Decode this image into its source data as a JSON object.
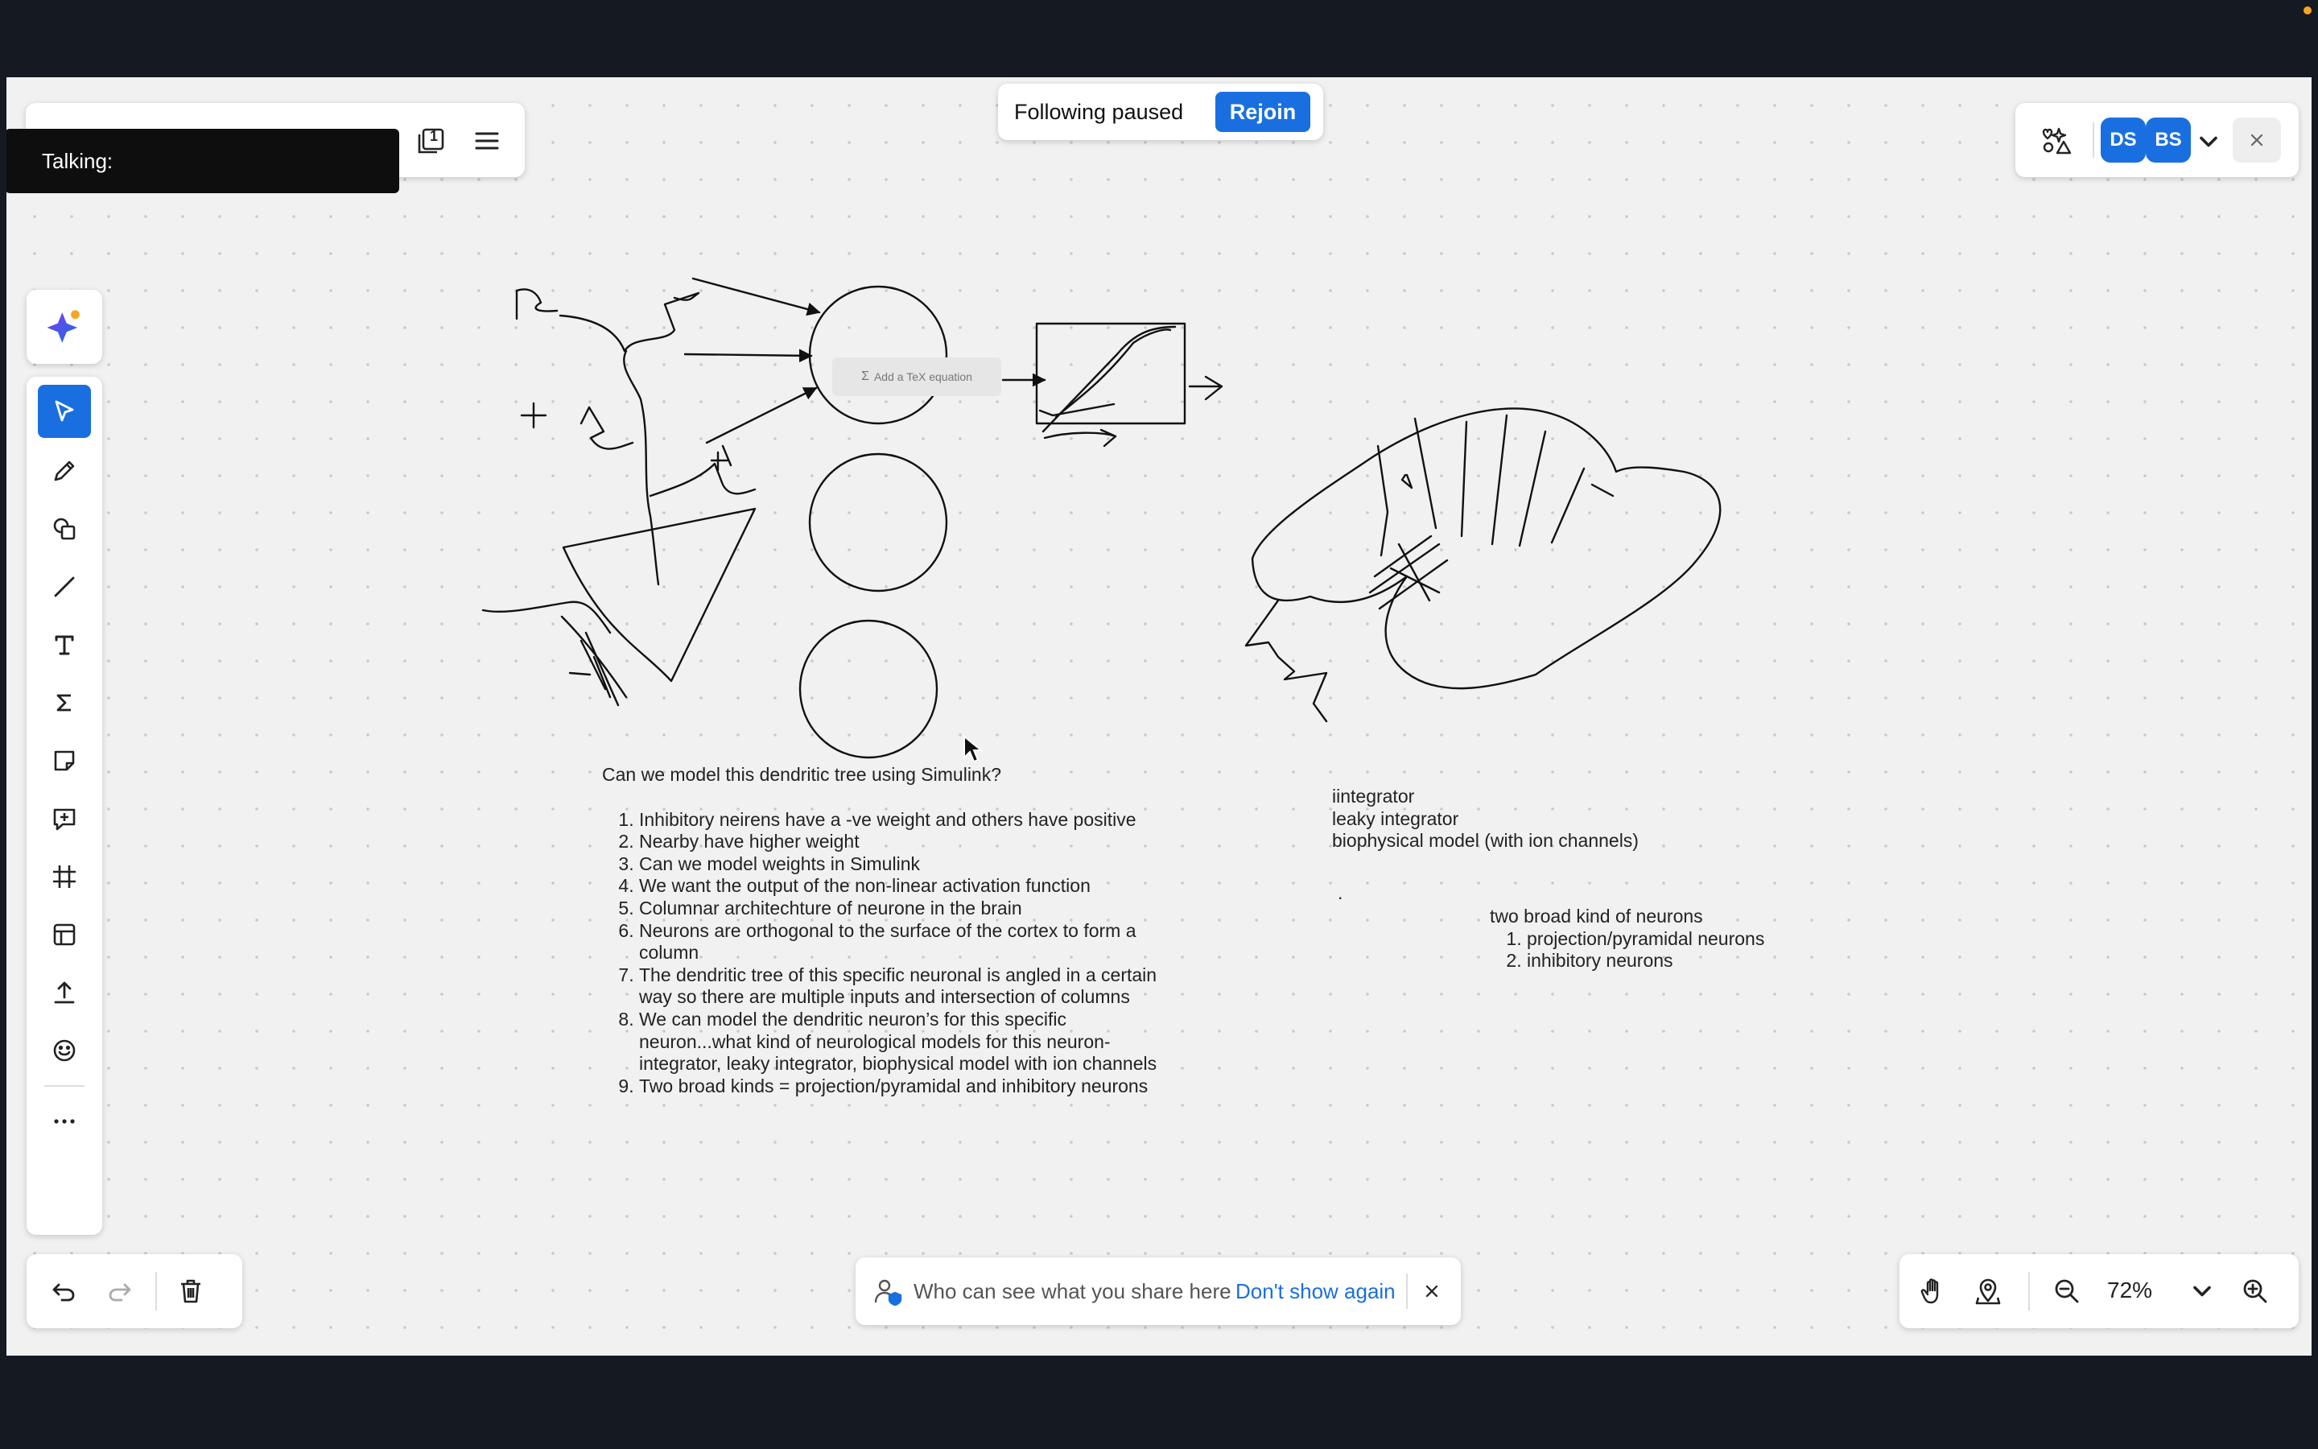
{
  "talking": {
    "label": "Talking:"
  },
  "frames": {
    "count": "1"
  },
  "following": {
    "text": "Following paused",
    "rejoin_label": "Rejoin"
  },
  "participants": [
    {
      "initials": "DS",
      "color": "#1a6fe0"
    },
    {
      "initials": "BS",
      "color": "#1a6fe0"
    }
  ],
  "tools": [
    "select",
    "pen",
    "shapes",
    "line",
    "text",
    "equation",
    "sticky-note",
    "comment",
    "frame",
    "template",
    "upload",
    "emoji",
    "more"
  ],
  "equation_placeholder": "Add a TeX equation",
  "notes": {
    "heading": "Can we model this dendritic tree using Simulink?",
    "items": [
      "Inhibitory neirens have a -ve weight and others have positive",
      "Nearby have higher weight",
      "Can we model weights in Simulink",
      "We want the output of the non-linear activation function",
      "Columnar architechture of neurone in the brain",
      "Neurons are orthogonal to the surface of the cortex to form a column",
      "The dendritic tree of this specific neuronal is angled in a certain way so there are multiple inputs and intersection of columns",
      "We can model the dendritic neuron’s for this specific neuron...what kind of neurological models for this neuron- integrator, leaky integrator, biophysical model with ion channels",
      "Two broad kinds = projection/pyramidal and inhibitory neurons"
    ]
  },
  "models": {
    "lines": [
      "iintegrator",
      "leaky integrator",
      "biophysical model (with ion channels)"
    ],
    "dot": "."
  },
  "neurons": {
    "heading": "two broad kind of neurons",
    "items": [
      "projection/pyramidal neurons",
      "inhibitory neurons"
    ]
  },
  "share_notice": {
    "text": "Who can see what you share here",
    "dont_show": "Don't show again"
  },
  "zoom": {
    "level": "72%"
  },
  "accent": "#1a6fe0"
}
